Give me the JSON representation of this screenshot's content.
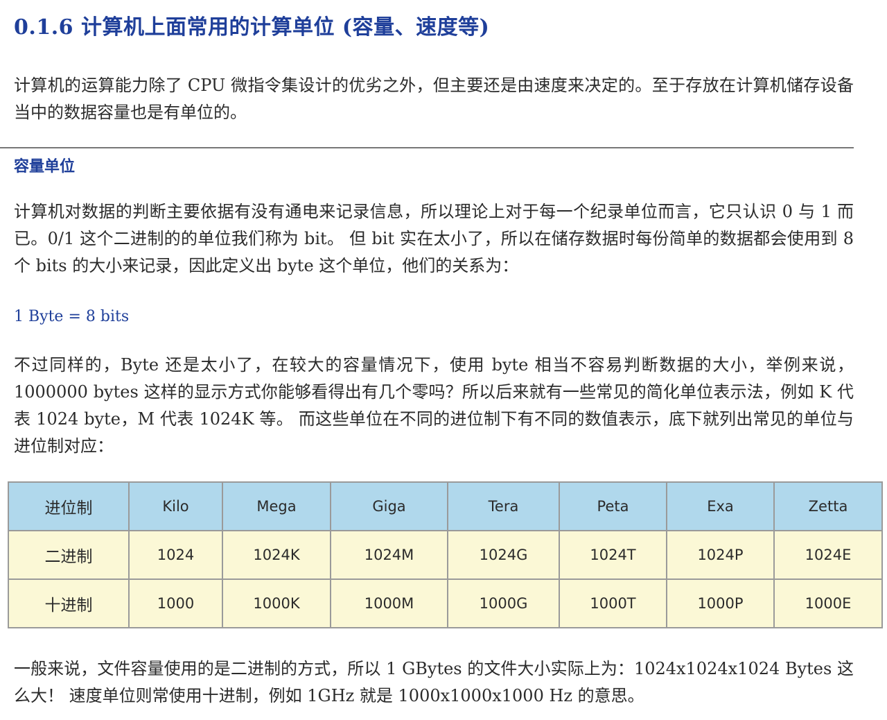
{
  "section": {
    "heading": "0.1.6 计算机上面常用的计算单位 (容量、速度等)",
    "intro": "计算机的运算能力除了 CPU 微指令集设计的优劣之外，但主要还是由速度来决定的。至于存放在计算机储存设备当中的数据容量也是有单位的。"
  },
  "capacity": {
    "subheading": "容量单位",
    "bit_paragraph": "计算机对数据的判断主要依据有没有通电来记录信息，所以理论上对于每一个纪录单位而言，它只认识 0 与 1 而已。0/1 这个二进制的的单位我们称为 bit。 但 bit 实在太小了，所以在储存数据时每份简单的数据都会使用到 8 个 bits 的大小来记录，因此定义出 byte 这个单位，他们的关系为：",
    "formula": "1 Byte = 8 bits",
    "byte_paragraph": "不过同样的，Byte 还是太小了，在较大的容量情况下，使用 byte 相当不容易判断数据的大小，举例来说，1000000 bytes 这样的显示方式你能够看得出有几个零吗？所以后来就有一些常见的简化单位表示法，例如 K 代表 1024 byte，M 代表 1024K 等。 而这些单位在不同的进位制下有不同的数值表示，底下就列出常见的单位与进位制对应："
  },
  "table": {
    "headers": [
      "进位制",
      "Kilo",
      "Mega",
      "Giga",
      "Tera",
      "Peta",
      "Exa",
      "Zetta"
    ],
    "rows": [
      [
        "二进制",
        "1024",
        "1024K",
        "1024M",
        "1024G",
        "1024T",
        "1024P",
        "1024E"
      ],
      [
        "十进制",
        "1000",
        "1000K",
        "1000M",
        "1000G",
        "1000T",
        "1000P",
        "1000E"
      ]
    ]
  },
  "closing": {
    "paragraph": "一般来说，文件容量使用的是二进制的方式，所以 1 GBytes 的文件大小实际上为：1024x1024x1024 Bytes 这么大！ 速度单位则常使用十进制，例如 1GHz 就是 1000x1000x1000 Hz 的意思。"
  },
  "colors": {
    "heading": "#1f3f9a",
    "body_text": "#2b2b2b",
    "table_header_bg": "#b0d8ec",
    "table_body_bg": "#fbf8d6",
    "table_border": "#9a9a9a"
  }
}
